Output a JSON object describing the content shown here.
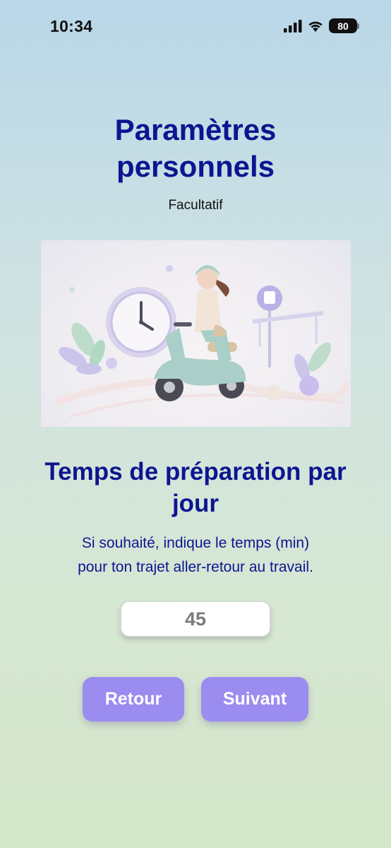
{
  "status_bar": {
    "time": "10:34",
    "battery_level": "80",
    "icons": [
      "cellular-signal-icon",
      "wifi-icon",
      "battery-icon"
    ]
  },
  "header": {
    "title_line1": "Paramètres",
    "title_line2": "personnels",
    "subtitle": "Facultatif"
  },
  "section": {
    "title_line1": "Temps de préparation par",
    "title_line2": "jour",
    "desc_line1": "Si souhaité, indique le temps (min)",
    "desc_line2": "pour ton trajet aller-retour au travail."
  },
  "input": {
    "value": "45"
  },
  "buttons": {
    "back": "Retour",
    "next": "Suivant"
  },
  "colors": {
    "title": "#0d1590",
    "button": "#9b8cef"
  }
}
